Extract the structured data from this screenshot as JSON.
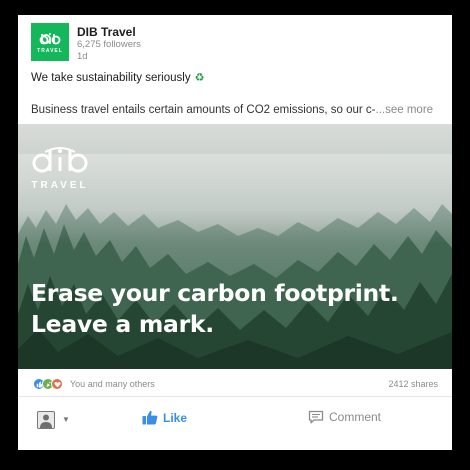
{
  "post": {
    "author": {
      "name": "DIB Travel",
      "followers": "6,275 followers",
      "time": "1d",
      "logo_text": "TRAVEL"
    },
    "title": "We take sustainability seriously",
    "title_emoji": "♻",
    "body": "Business travel entails certain amounts of CO2 emissions, so our c-",
    "see_more": "...see more",
    "image": {
      "brand_text": "TRAVEL",
      "headline_line1": "Erase your carbon footprint.",
      "headline_line2": "Leave a mark."
    },
    "reactions": {
      "icons": [
        "like-icon",
        "celebrate-icon",
        "love-icon"
      ],
      "text": "You and many others",
      "shares": "2412 shares"
    },
    "actions": {
      "like": "Like",
      "comment": "Comment"
    }
  },
  "colors": {
    "brand_green": "#14b85a",
    "like_blue": "#378fe9",
    "muted": "#8a8a8a"
  }
}
